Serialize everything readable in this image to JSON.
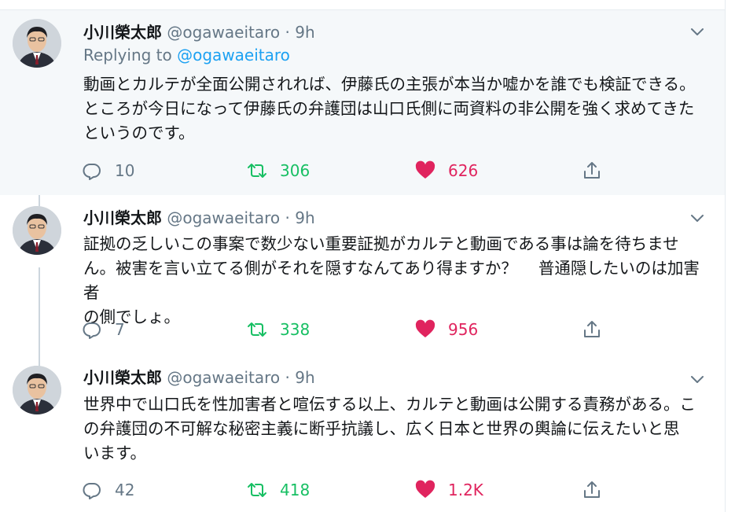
{
  "tweets": [
    {
      "name": "小川榮太郎",
      "handle": "@ogawaeitaro",
      "separator": "·",
      "time": "9h",
      "replying_prefix": "Replying to",
      "replying_handle": "@ogawaeitaro",
      "lines": [
        "動画とカルテが全面公開されれば、伊藤氏の主張が本当か嘘かを誰でも検証できる。",
        "ところが今日になって伊藤氏の弁護団は山口氏側に両資料の非公開を強く求めてきた",
        "というのです。"
      ],
      "replies": "10",
      "retweets": "306",
      "likes": "626"
    },
    {
      "name": "小川榮太郎",
      "handle": "@ogawaeitaro",
      "separator": "·",
      "time": "9h",
      "lines": [
        "証拠の乏しいこの事案で数少ない重要証拠がカルテと動画である事は論を待ちませ",
        "ん。被害を言い立てる側がそれを隠すなんてあり得ますか？　 普通隠したいのは加害者",
        "の側でしょ。"
      ],
      "replies": "7",
      "retweets": "338",
      "likes": "956"
    },
    {
      "name": "小川榮太郎",
      "handle": "@ogawaeitaro",
      "separator": "·",
      "time": "9h",
      "lines": [
        "世界中で山口氏を性加害者と喧伝する以上、カルテと動画は公開する責務がある。こ",
        "の弁護団の不可解な秘密主義に断乎抗議し、広く日本と世界の輿論に伝えたいと思",
        "います。"
      ],
      "replies": "42",
      "retweets": "418",
      "likes": "1.2K"
    }
  ],
  "icons": {
    "reply": "reply-icon",
    "retweet": "retweet-icon",
    "like": "heart-icon",
    "share": "share-icon",
    "menu": "chevron-down-icon"
  },
  "colors": {
    "highlight_bg": "#f5f8fa",
    "name": "#14171a",
    "secondary": "#657786",
    "link": "#1da1f2",
    "retweet": "#17bf63",
    "like": "#e0245e",
    "thread_line": "#ccd6dd"
  }
}
